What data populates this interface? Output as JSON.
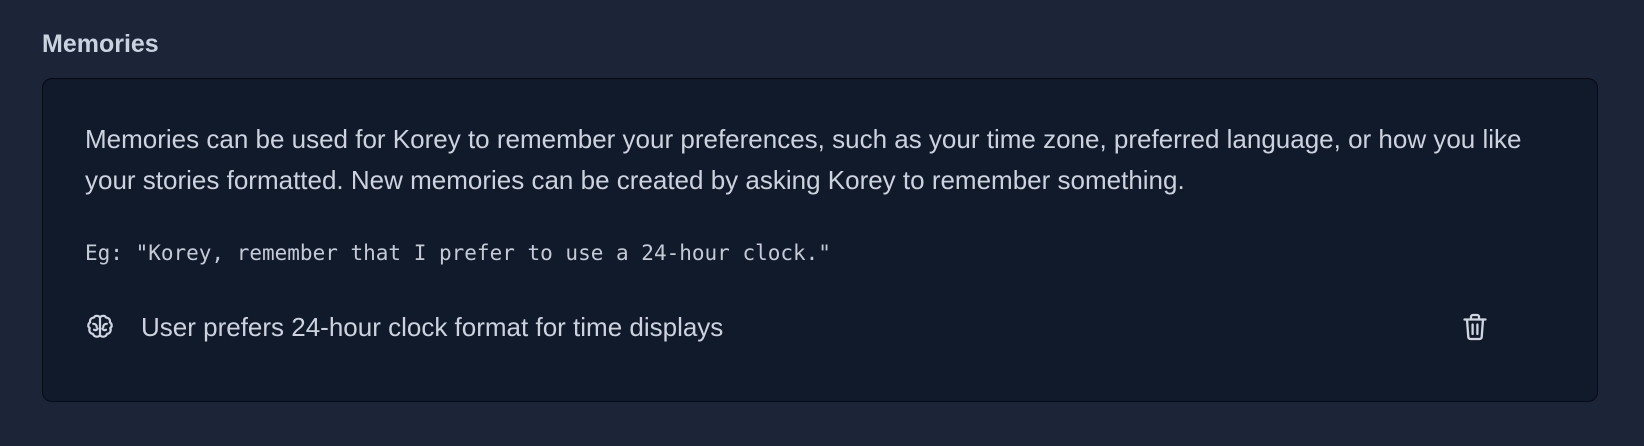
{
  "section": {
    "title": "Memories"
  },
  "card": {
    "description": "Memories can be used for Korey to remember your preferences, such as your time zone, preferred language, or how you like your stories formatted. New memories can be created by asking Korey to remember something.",
    "example": "Eg: \"Korey, remember that I prefer to use a 24-hour clock.\""
  },
  "memories": [
    {
      "icon": "brain-icon",
      "text": "User prefers 24-hour clock format for time displays",
      "delete_icon": "trash-icon"
    }
  ],
  "colors": {
    "page_background": "#1b2537",
    "card_background": "#111a2b",
    "text": "#ccd3de",
    "title": "#c9d2df"
  }
}
